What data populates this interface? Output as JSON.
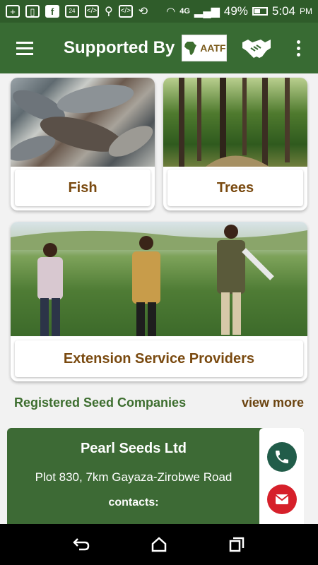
{
  "status_bar": {
    "battery": "49%",
    "time": "5:04",
    "ampm": "PM",
    "network": "4G"
  },
  "app_bar": {
    "title": "Supported By",
    "logo_text": "AATF"
  },
  "cards": {
    "fish": {
      "label": "Fish"
    },
    "trees": {
      "label": "Trees"
    },
    "extension": {
      "label": "Extension Service Providers"
    }
  },
  "section": {
    "title": "Registered Seed Companies",
    "view_more": "view more"
  },
  "company": {
    "name": "Pearl Seeds Ltd",
    "address": "Plot 830, 7km Gayaza-Zirobwe Road",
    "contacts_label": "contacts:"
  },
  "colors": {
    "app_bar": "#386b33",
    "label_text": "#7a4a10",
    "section_text": "#3d6e2f",
    "call_button": "#215c49",
    "email_button": "#d6202a"
  }
}
